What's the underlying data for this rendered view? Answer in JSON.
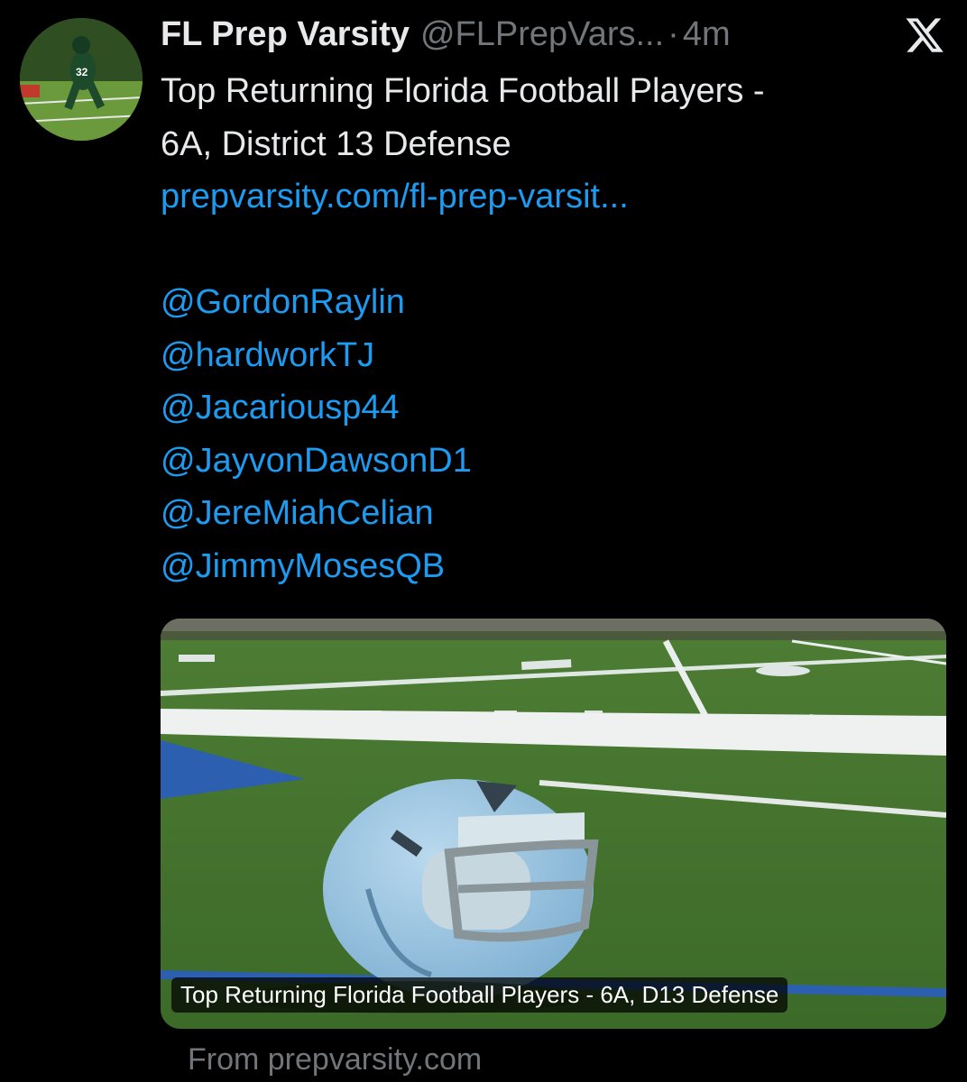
{
  "author": {
    "display_name": "FL Prep Varsity",
    "handle": "@FLPrepVars...",
    "separator": "·",
    "time": "4m"
  },
  "icons": {
    "platform_logo": "x-logo-icon",
    "avatar": "avatar-football-player"
  },
  "tweet": {
    "text_lines": [
      "Top Returning Florida Football Players -",
      "6A, District 13 Defense"
    ],
    "link": "prepvarsity.com/fl-prep-varsit...",
    "mentions": [
      "@GordonRaylin",
      "@hardworkTJ",
      "@Jacariousp44",
      "@JayvonDawsonD1",
      "@JereMiahCelian",
      "@JimmyMosesQB"
    ]
  },
  "card": {
    "caption": "Top Returning Florida Football Players - 6A, D13 Defense",
    "source": "From prepvarsity.com"
  },
  "colors": {
    "background": "#000000",
    "text": "#e7e9ea",
    "secondary": "#71767b",
    "link": "#1d9bf0"
  }
}
